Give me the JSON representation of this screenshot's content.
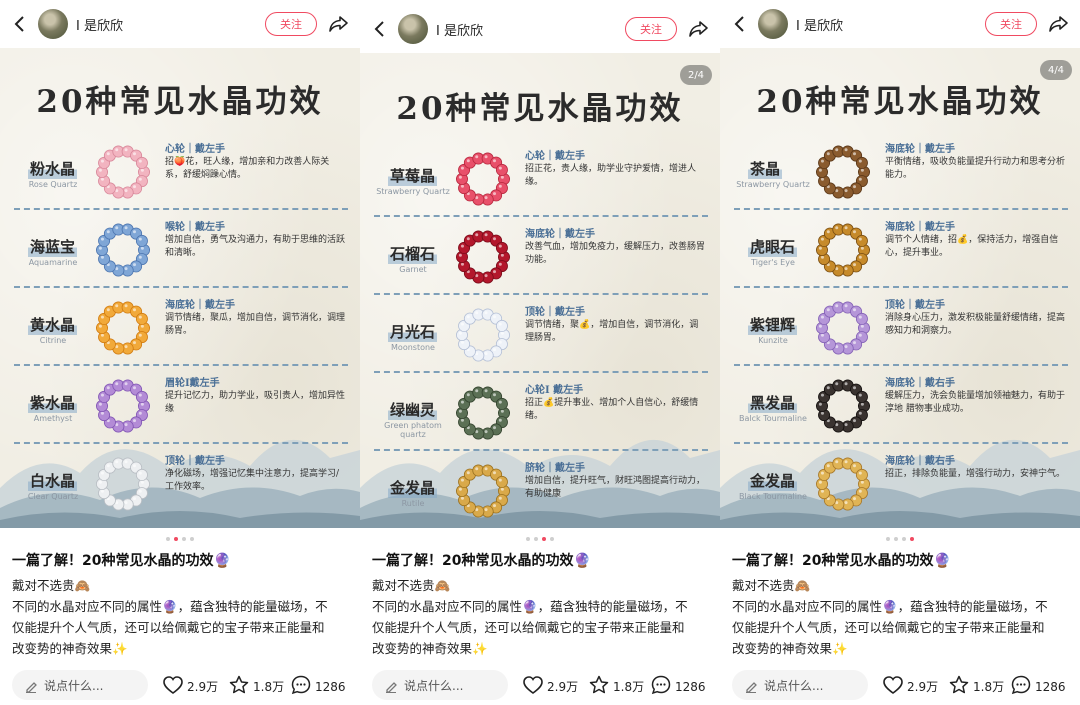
{
  "post": {
    "username": "I 是欣欣",
    "follow_label": "关注",
    "title": "一篇了解！20种常见水晶的功效🔮",
    "body_lines": [
      "戴对不选贵🙈",
      "不同的水晶对应不同的属性🔮，蕴含独特的能量磁场，不",
      "仅能提升个人气质，还可以给佩戴它的宝子带来正能量和",
      "改变势的神奇效果✨"
    ],
    "comment_placeholder": "说点什么...",
    "likes": "2.9万",
    "collects": "1.8万",
    "comments": "1286"
  },
  "poster_title": "20种常见水晶功效",
  "panels": [
    {
      "page_badge": "",
      "active_dot": 1,
      "items": [
        {
          "name": "粉水晶",
          "en": "Rose Quartz",
          "chakra": "心轮｜戴左手",
          "desc": "招🍑花，旺人缘，增加亲和力改善人际关系，舒缓焖躁心情。",
          "color": "#f2b4c0",
          "shade": "#d9899b"
        },
        {
          "name": "海蓝宝",
          "en": "Aquamarine",
          "chakra": "喉轮｜戴左手",
          "desc": "增加自信，勇气及沟通力，有助于思维的活跃和清晰。",
          "color": "#7fa6d6",
          "shade": "#4d76b0"
        },
        {
          "name": "黄水晶",
          "en": "Citrine",
          "chakra": "海底轮｜戴左手",
          "desc": "调节情绪，聚瓜，增加自信，调节消化，调理肠胃。",
          "color": "#f1a93a",
          "shade": "#d27d12"
        },
        {
          "name": "紫水晶",
          "en": "Amethyst",
          "chakra": "眉轮I戴左手",
          "desc": "提升记忆力，助力学业，吸引贵人，增加异性缘",
          "color": "#b38bd6",
          "shade": "#8256b4"
        },
        {
          "name": "白水晶",
          "en": "Clear Quartz",
          "chakra": "顶轮｜戴左手",
          "desc": "净化磁场，增强记忆集中注意力，提高学习/工作效率。",
          "color": "#eef0f2",
          "shade": "#b9bec4"
        }
      ]
    },
    {
      "page_badge": "2/4",
      "active_dot": 2,
      "items": [
        {
          "name": "草莓晶",
          "en": "Strawberry Quartz",
          "chakra": "心轮｜戴左手",
          "desc": "招正花，贵人缘，助学业守护爱情，增进人缘。",
          "color": "#e8506a",
          "shade": "#b8293f"
        },
        {
          "name": "石榴石",
          "en": "Garnet",
          "chakra": "海底轮｜戴左手",
          "desc": "改善气血，增加免疫力，缓解压力，改善肠胃功能。",
          "color": "#b3172c",
          "shade": "#7a0c1a"
        },
        {
          "name": "月光石",
          "en": "Moonstone",
          "chakra": "顶轮｜戴左手",
          "desc": "调节情绪，聚💰，增加自信，调节消化，调理肠胃。",
          "color": "#eef2f8",
          "shade": "#b5c0d6"
        },
        {
          "name": "绿幽灵",
          "en": "Green phatom quartz",
          "chakra": "心轮I 戴左手",
          "desc": "招正💰提升事业、增加个人自信心，舒缓情绪。",
          "color": "#5b7055",
          "shade": "#34442f"
        },
        {
          "name": "金发晶",
          "en": "Rutile",
          "chakra": "脐轮｜戴左手",
          "desc": "增加自信，提升旺气，财旺鸿图提高行动力，有助健康",
          "color": "#d9a94a",
          "shade": "#9c7220"
        }
      ]
    },
    {
      "page_badge": "4/4",
      "active_dot": 3,
      "items": [
        {
          "name": "茶晶",
          "en": "Strawberry Quartz",
          "chakra": "海底轮｜戴左手",
          "desc": "平衡情绪，吸收负能量提升行动力和思考分析能力。",
          "color": "#8a5b2e",
          "shade": "#5a3718"
        },
        {
          "name": "虎眼石",
          "en": "Tiger's Eye",
          "chakra": "海底轮｜戴左手",
          "desc": "调节个人情绪，招💰，保持活力，增强自信心，提升事业。",
          "color": "#c68a2a",
          "shade": "#7a4e12"
        },
        {
          "name": "紫锂辉",
          "en": "Kunzite",
          "chakra": "顶轮｜戴左手",
          "desc": "消除身心压力，激发积极能量舒缓情绪，提高感知力和洞察力。",
          "color": "#b596d8",
          "shade": "#8462b6"
        },
        {
          "name": "黑发晶",
          "en": "Balck Tourmaline",
          "chakra": "海底轮｜戴右手",
          "desc": "缓解压力，洗会负能量增加领袖魅力，有助于淳地 腊物事业成功。",
          "color": "#3a3330",
          "shade": "#151110"
        },
        {
          "name": "金发晶",
          "en": "Black Tourmaline",
          "chakra": "海底轮｜戴右手",
          "desc": "招正，排除负能量，增强行动力，安神宁气。",
          "color": "#e0b455",
          "shade": "#a7782a"
        }
      ]
    }
  ]
}
